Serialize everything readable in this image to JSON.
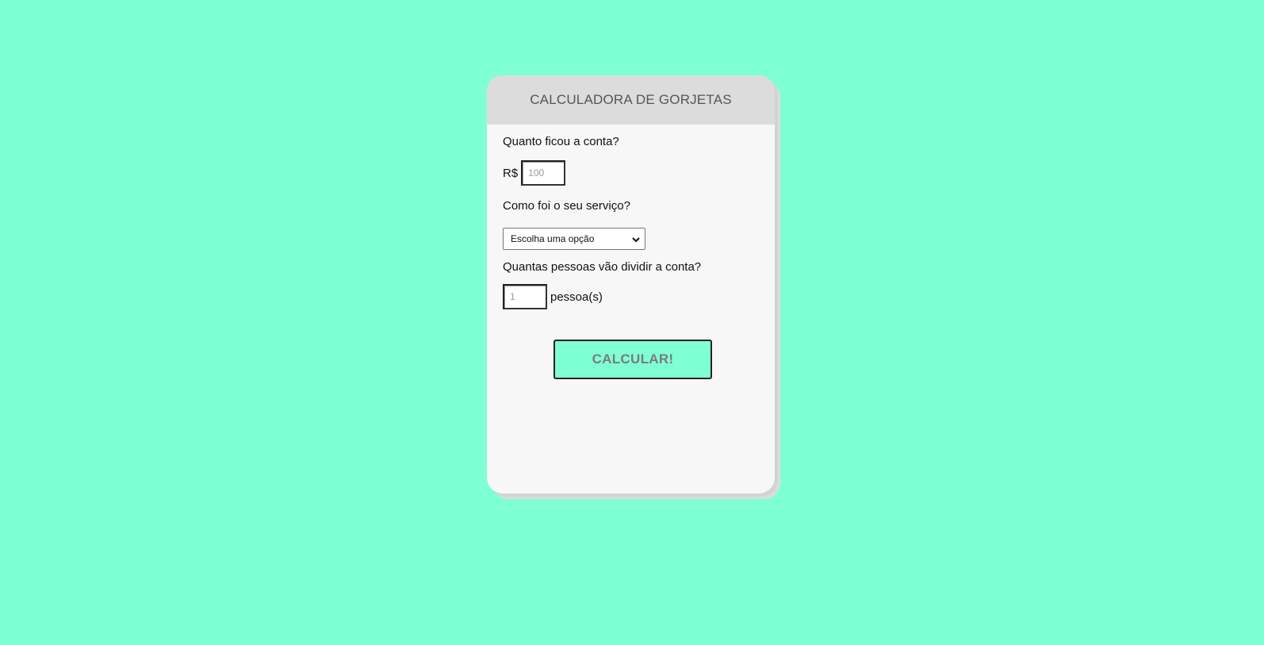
{
  "card": {
    "title": "CALCULADORA DE GORJETAS"
  },
  "bill": {
    "question": "Quanto ficou a conta?",
    "currency": "R$",
    "placeholder": "100",
    "value": ""
  },
  "service": {
    "question": "Como foi o seu serviço?",
    "selected": "Escolha uma opção"
  },
  "people": {
    "question": "Quantas pessoas vão dividir a conta?",
    "placeholder": "1",
    "value": "",
    "unit": "pessoa(s)"
  },
  "action": {
    "label": "CALCULAR!"
  },
  "colors": {
    "background": "#7fffd4",
    "card": "#f7f7f7",
    "header": "#dcdcdc",
    "button": "#7fffd4"
  }
}
